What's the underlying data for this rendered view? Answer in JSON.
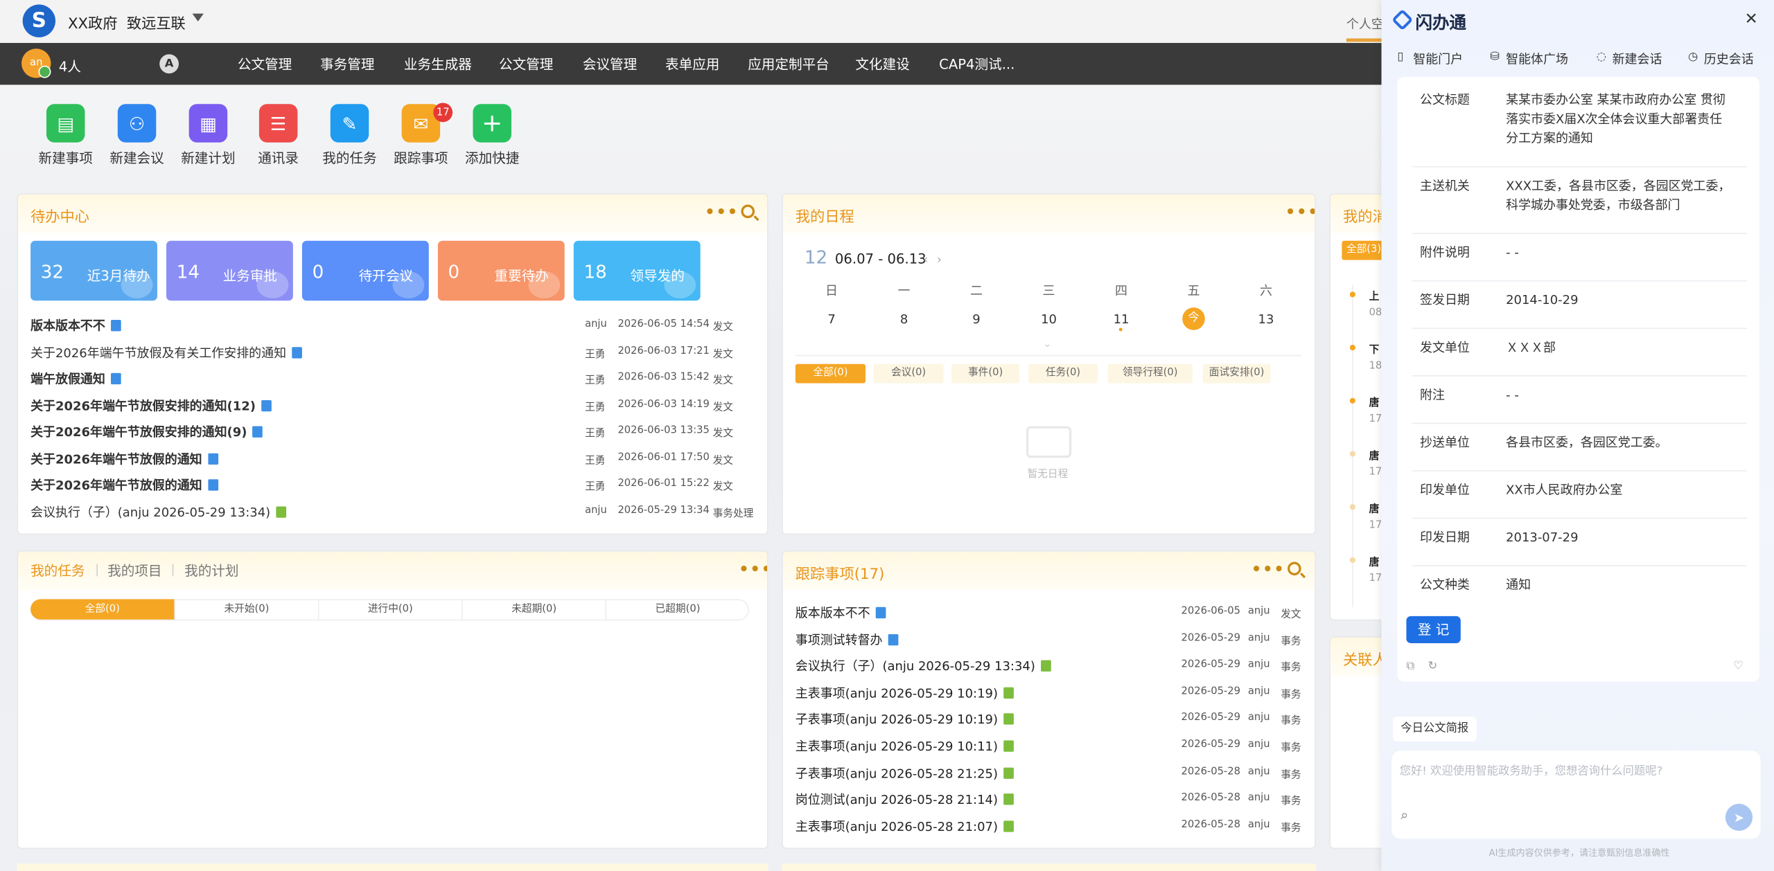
{
  "topbar": {
    "org": "XX政府",
    "unit": "致远互联",
    "right_tab": "个人空"
  },
  "nav": {
    "people_count": "4人",
    "avatar_text": "an",
    "items": [
      "公文管理",
      "事务管理",
      "业务生成器",
      "公文管理",
      "会议管理",
      "表单应用",
      "应用定制平台",
      "文化建设",
      "CAP4测试..."
    ]
  },
  "quick": {
    "items": [
      {
        "label": "新建事项",
        "icon": "new-item-icon",
        "color": "#2fbf5a"
      },
      {
        "label": "新建会议",
        "icon": "new-meeting-icon",
        "color": "#2f86f0"
      },
      {
        "label": "新建计划",
        "icon": "new-plan-icon",
        "color": "#7a5cf0"
      },
      {
        "label": "通讯录",
        "icon": "contacts-icon",
        "color": "#ee4b4b"
      },
      {
        "label": "我的任务",
        "icon": "my-task-icon",
        "color": "#1f9bf0"
      },
      {
        "label": "跟踪事项",
        "icon": "track-icon",
        "color": "#f5a623"
      },
      {
        "label": "添加快捷",
        "icon": "add-icon",
        "color": "#27c25f"
      }
    ],
    "track_badge": "17"
  },
  "todo": {
    "title": "待办中心",
    "tiles": [
      {
        "num": "32",
        "label": "近3月待办",
        "color": "#5aa9f0"
      },
      {
        "num": "14",
        "label": "业务审批",
        "color": "#8b8ff5"
      },
      {
        "num": "0",
        "label": "待开会议",
        "color": "#5b8ff9"
      },
      {
        "num": "0",
        "label": "重要待办",
        "color": "#f79468"
      },
      {
        "num": "18",
        "label": "领导发的",
        "color": "#45b8f5"
      }
    ],
    "rows": [
      {
        "title": "版本版本不不",
        "bold": true,
        "doc": "blue",
        "user": "anju",
        "time": "2026-06-05 14:54",
        "type": "发文"
      },
      {
        "title": "关于2026年端午节放假及有关工作安排的通知",
        "bold": false,
        "doc": "blue",
        "user": "王勇",
        "time": "2026-06-03 17:21",
        "type": "发文"
      },
      {
        "title": "端午放假通知",
        "bold": true,
        "doc": "blue",
        "user": "王勇",
        "time": "2026-06-03 15:42",
        "type": "发文"
      },
      {
        "title": "关于2026年端午节放假安排的通知(12)",
        "bold": true,
        "doc": "blue",
        "user": "王勇",
        "time": "2026-06-03 14:19",
        "type": "发文"
      },
      {
        "title": "关于2026年端午节放假安排的通知(9)",
        "bold": true,
        "doc": "blue",
        "user": "王勇",
        "time": "2026-06-03 13:35",
        "type": "发文"
      },
      {
        "title": "关于2026年端午节放假的通知",
        "bold": true,
        "doc": "blue",
        "user": "王勇",
        "time": "2026-06-01 17:50",
        "type": "发文"
      },
      {
        "title": "关于2026年端午节放假的通知",
        "bold": true,
        "doc": "blue",
        "user": "王勇",
        "time": "2026-06-01 15:22",
        "type": "发文"
      },
      {
        "title": "会议执行（子）(anju 2026-05-29 13:34)",
        "bold": false,
        "doc": "green",
        "user": "anju",
        "time": "2026-05-29 13:34",
        "type": "事务处理"
      }
    ]
  },
  "schedule": {
    "title": "我的日程",
    "month": "12",
    "range": "06.07 - 06.13",
    "weekdays": [
      "日",
      "一",
      "二",
      "三",
      "四",
      "五",
      "六"
    ],
    "days": [
      "7",
      "8",
      "9",
      "10",
      "11",
      "今",
      "13"
    ],
    "chips": [
      "全部(0)",
      "会议(0)",
      "事件(0)",
      "任务(0)",
      "领导行程(0)",
      "面试安排(0)"
    ],
    "empty": "暂无日程"
  },
  "messages": {
    "title": "我的消",
    "chip": "全部(3)",
    "items": [
      {
        "t": "上",
        "d": "08"
      },
      {
        "t": "下",
        "d": "18"
      },
      {
        "t": "唐",
        "d": "17"
      },
      {
        "t": "唐",
        "d": "17"
      },
      {
        "t": "唐",
        "d": "17"
      },
      {
        "t": "唐",
        "d": "17"
      }
    ]
  },
  "related": {
    "title": "关联人"
  },
  "tasks": {
    "tabs_header": [
      "我的任务",
      "我的项目",
      "我的计划"
    ],
    "tabs": [
      "全部(0)",
      "未开始(0)",
      "进行中(0)",
      "未超期(0)",
      "已超期(0)"
    ]
  },
  "track": {
    "title": "跟踪事项(17)",
    "rows": [
      {
        "title": "版本版本不不",
        "doc": "blue",
        "date": "2026-06-05",
        "user": "anju",
        "type": "发文"
      },
      {
        "title": "事项测试转督办",
        "doc": "blue",
        "date": "2026-05-29",
        "user": "anju",
        "type": "事务"
      },
      {
        "title": "会议执行（子）(anju 2026-05-29 13:34)",
        "doc": "green",
        "date": "2026-05-29",
        "user": "anju",
        "type": "事务"
      },
      {
        "title": "主表事项(anju 2026-05-29 10:19)",
        "doc": "green",
        "date": "2026-05-29",
        "user": "anju",
        "type": "事务"
      },
      {
        "title": "子表事项(anju 2026-05-29 10:19)",
        "doc": "green",
        "date": "2026-05-29",
        "user": "anju",
        "type": "事务"
      },
      {
        "title": "主表事项(anju 2026-05-29 10:11)",
        "doc": "green",
        "date": "2026-05-29",
        "user": "anju",
        "type": "事务"
      },
      {
        "title": "子表事项(anju 2026-05-28 21:25)",
        "doc": "green",
        "date": "2026-05-28",
        "user": "anju",
        "type": "事务"
      },
      {
        "title": "岗位测试(anju 2026-05-28 21:14)",
        "doc": "green",
        "date": "2026-05-28",
        "user": "anju",
        "type": "事务"
      },
      {
        "title": "主表事项(anju 2026-05-28 21:07)",
        "doc": "green",
        "date": "2026-05-28",
        "user": "anju",
        "type": "事务"
      }
    ]
  },
  "panel": {
    "title": "闪办通",
    "toolbar": [
      "智能门户",
      "智能体广场",
      "新建会话",
      "历史会话"
    ],
    "fields": [
      {
        "label": "公文标题",
        "value": "某某市委办公室 某某市政府办公室 贯彻落实市委X届X次全体会议重大部署责任分工方案的通知"
      },
      {
        "label": "主送机关",
        "value": "XXX工委，各县市区委，各园区党工委，科学城办事处党委，市级各部门"
      },
      {
        "label": "附件说明",
        "value": "- -"
      },
      {
        "label": "签发日期",
        "value": "2014-10-29"
      },
      {
        "label": "发文单位",
        "value": "ＸＸＸ部"
      },
      {
        "label": "附注",
        "value": "- -"
      },
      {
        "label": "抄送单位",
        "value": "各县市区委，各园区党工委。"
      },
      {
        "label": "印发单位",
        "value": "XX市人民政府办公室"
      },
      {
        "label": "印发日期",
        "value": "2013-07-29"
      },
      {
        "label": "公文种类",
        "value": "通知"
      }
    ],
    "register": "登 记",
    "brief": "今日公文简报",
    "chat_placeholder": "您好! 欢迎使用智能政务助手，您想咨询什么问题呢?",
    "disclaimer": "AI生成内容仅供参考，请注意甄别信息准确性"
  }
}
